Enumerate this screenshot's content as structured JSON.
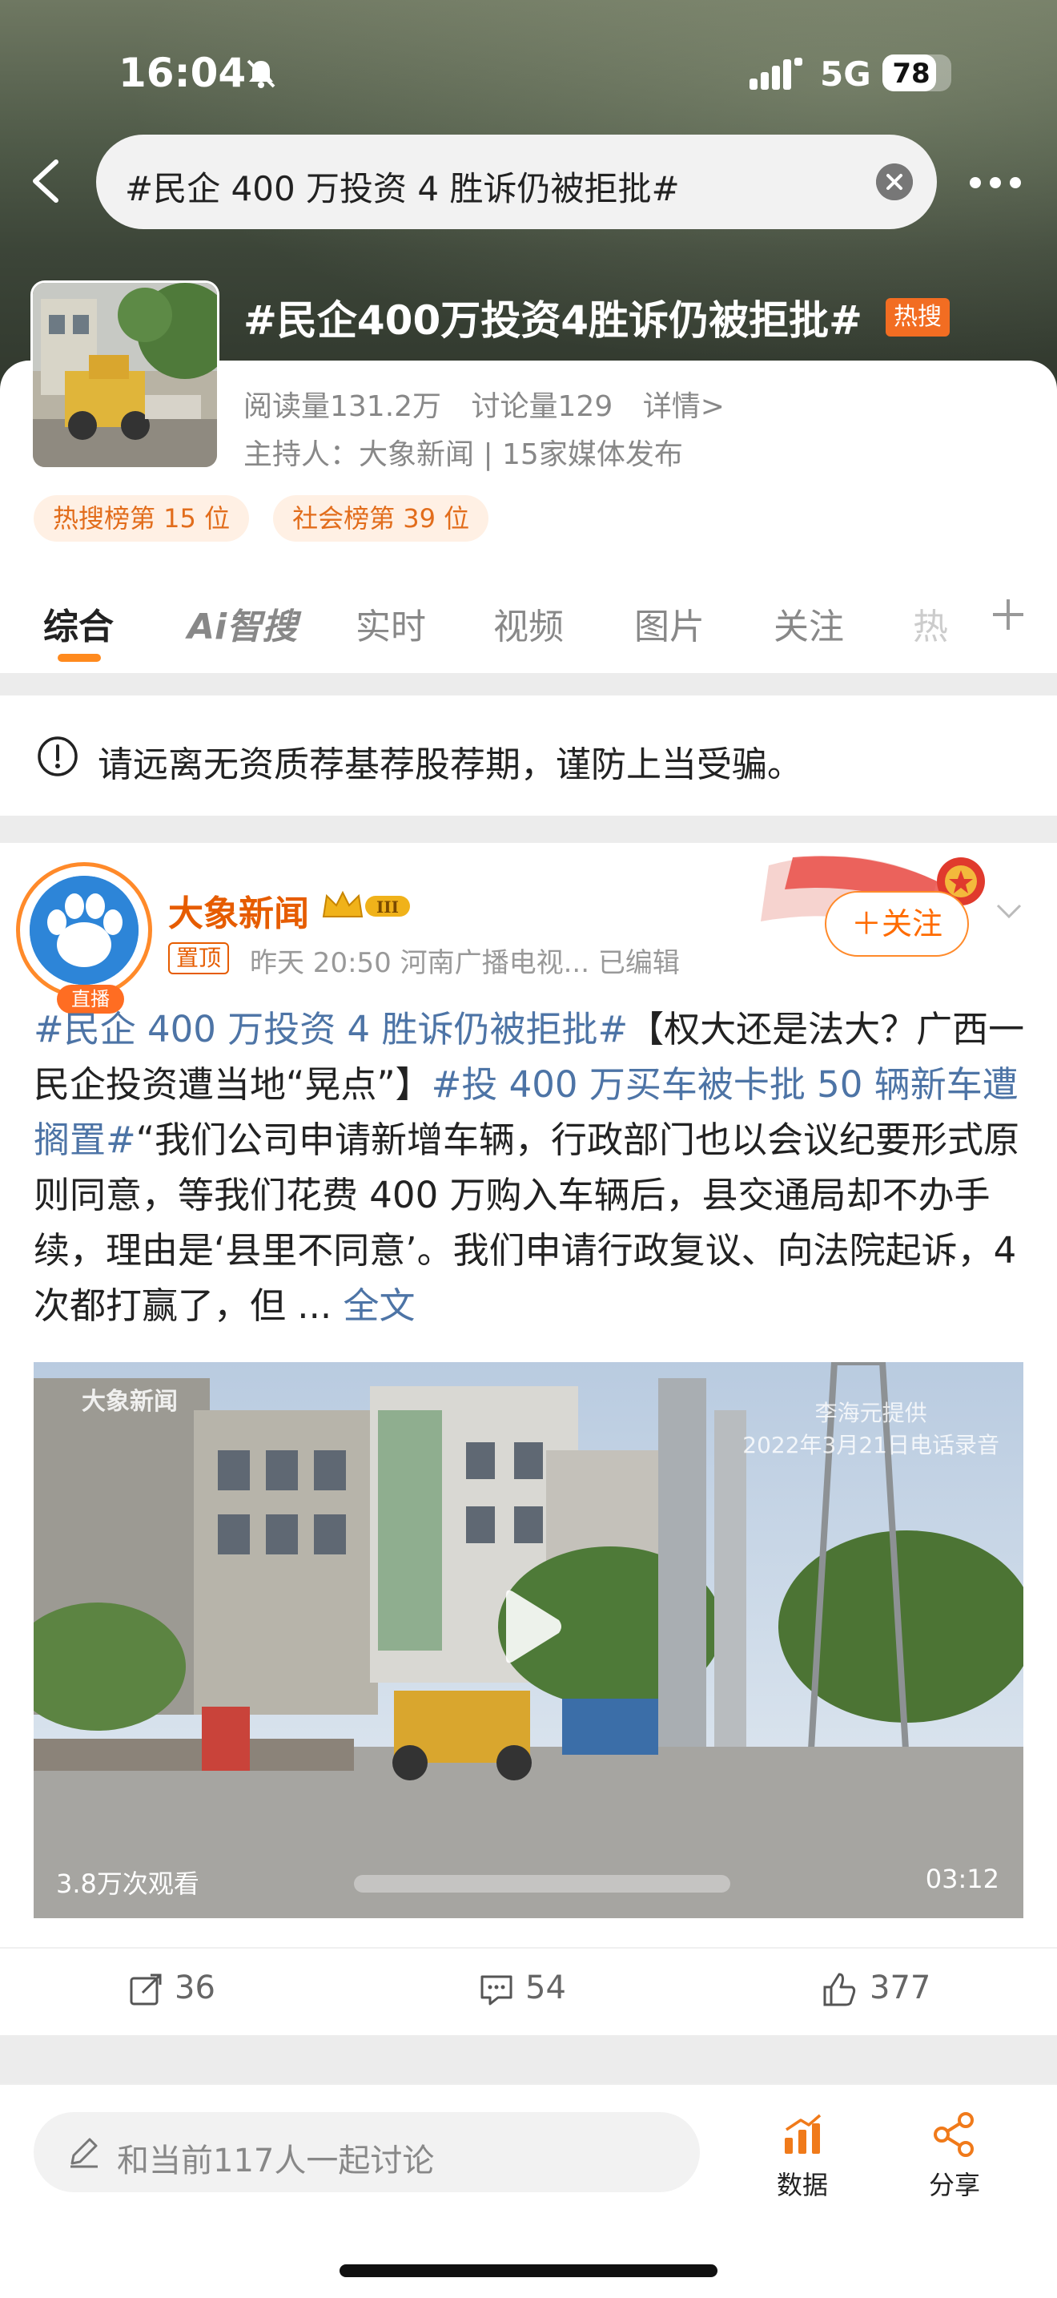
{
  "status_bar": {
    "time": "16:04",
    "network": "5G",
    "battery": "78"
  },
  "search": {
    "query": "#民企 400 万投资 4 胜诉仍被拒批#"
  },
  "topic": {
    "title": "#民企400万投资4胜诉仍被拒批#",
    "badge": "热搜",
    "reads": "阅读量131.2万",
    "discussions": "讨论量129",
    "details": "详情>",
    "host": "主持人：大象新闻 | 15家媒体发布",
    "ranks": [
      "热搜榜第 15 位",
      "社会榜第 39 位"
    ]
  },
  "tabs": [
    "综合",
    "Ai智搜",
    "实时",
    "视频",
    "图片",
    "关注",
    "热"
  ],
  "notice": {
    "text": "请远离无资质荐基荐股荐期，谨防上当受骗。"
  },
  "post": {
    "author": "大象新闻",
    "live_tag": "直播",
    "pinned": "置顶",
    "meta": "昨天 20:50  河南广播电视...  已编辑",
    "follow": "＋关注",
    "hashtag1": "#民企 400 万投资 4 胜诉仍被拒批#",
    "text1": "【权大还是法大？广西一民企投资遭当地“晃点”】",
    "hashtag2": "#投 400 万买车被卡批 50 辆新车遭搁置#",
    "text2": "“我们公司申请新增车辆，行政部门也以会议纪要形式原则同意，等我们花费 400 万购入车辆后，县交通局却不办手续，理由是‘县里不同意’。我们申请行政复议、向法院起诉，4 次都打赢了，但 ... ",
    "full_text": "全文",
    "video": {
      "watermark": "大象新闻",
      "caption_line1": "李海元提供",
      "caption_line2": "2022年3月21日电话录音",
      "views": "3.8万次观看",
      "duration": "03:12"
    },
    "shares": "36",
    "comments": "54",
    "likes": "377"
  },
  "bottom_bar": {
    "comment_placeholder": "和当前117人一起讨论",
    "data_label": "数据",
    "share_label": "分享"
  },
  "colors": {
    "accent": "#ff8a1e",
    "link": "#4d74a6",
    "author": "#e65c00"
  }
}
